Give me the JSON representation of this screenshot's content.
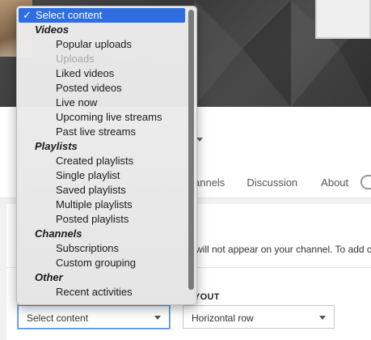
{
  "channel": {
    "tabs": [
      "annels",
      "Discussion",
      "About"
    ],
    "notice": "will not appear on your channel. To add c",
    "layout_label": "YOUT"
  },
  "section_form": {
    "content_select_value": "Select content",
    "layout_select_value": "Horizontal row"
  },
  "menu": {
    "selected": {
      "check": "✓",
      "label": "Select content"
    },
    "items": [
      {
        "type": "group",
        "label": "Videos"
      },
      {
        "type": "option",
        "label": "Popular uploads"
      },
      {
        "type": "option",
        "label": "Uploads",
        "disabled": true
      },
      {
        "type": "option",
        "label": "Liked videos"
      },
      {
        "type": "option",
        "label": "Posted videos"
      },
      {
        "type": "option",
        "label": "Live now"
      },
      {
        "type": "option",
        "label": "Upcoming live streams"
      },
      {
        "type": "option",
        "label": "Past live streams"
      },
      {
        "type": "group",
        "label": "Playlists"
      },
      {
        "type": "option",
        "label": "Created playlists"
      },
      {
        "type": "option",
        "label": "Single playlist"
      },
      {
        "type": "option",
        "label": "Saved playlists"
      },
      {
        "type": "option",
        "label": "Multiple playlists"
      },
      {
        "type": "option",
        "label": "Posted playlists"
      },
      {
        "type": "group",
        "label": "Channels"
      },
      {
        "type": "option",
        "label": "Subscriptions"
      },
      {
        "type": "option",
        "label": "Custom grouping"
      },
      {
        "type": "group",
        "label": "Other"
      },
      {
        "type": "option",
        "label": "Recent activities"
      }
    ]
  }
}
